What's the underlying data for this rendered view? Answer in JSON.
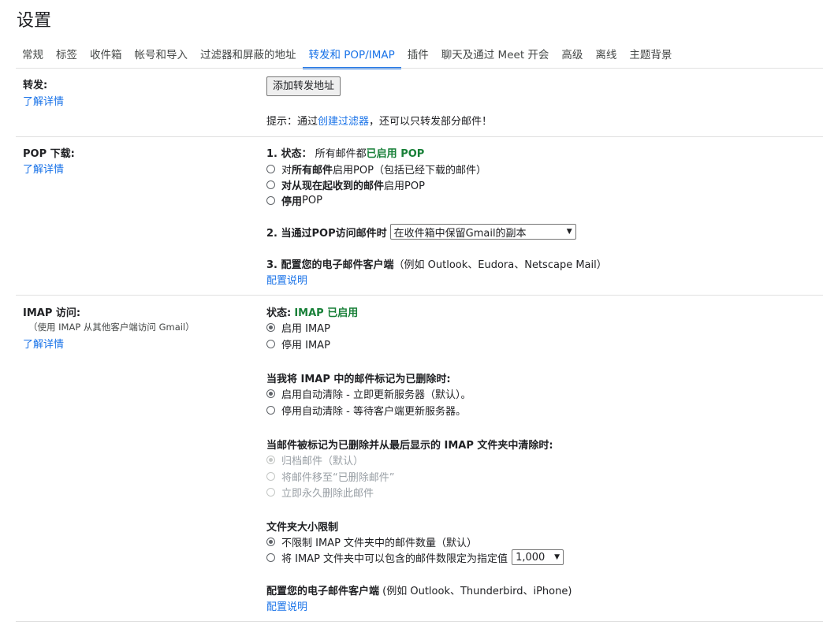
{
  "page_title": "设置",
  "tabs": [
    {
      "label": "常规"
    },
    {
      "label": "标签"
    },
    {
      "label": "收件箱"
    },
    {
      "label": "帐号和导入"
    },
    {
      "label": "过滤器和屏蔽的地址"
    },
    {
      "label": "转发和 POP/IMAP",
      "active": true
    },
    {
      "label": "插件"
    },
    {
      "label": "聊天及通过 Meet 开会"
    },
    {
      "label": "高级"
    },
    {
      "label": "离线"
    },
    {
      "label": "主题背景"
    }
  ],
  "forwarding": {
    "label": "转发:",
    "learn_more": "了解详情",
    "add_button": "添加转发地址",
    "tip_prefix": "提示：通过",
    "tip_link": "创建过滤器",
    "tip_suffix": "，还可以只转发部分邮件！"
  },
  "pop": {
    "label": "POP 下载:",
    "learn_more": "了解详情",
    "status_label": "1. 状态：",
    "status_text": "所有邮件都",
    "status_value": "已启用 POP",
    "options": [
      {
        "pre": "对",
        "bold": "所有邮件",
        "post": "启用POP（包括已经下载的邮件）",
        "checked": false
      },
      {
        "pre": "",
        "bold": "对从现在起收到的邮件",
        "post": "启用POP",
        "checked": false
      },
      {
        "pre": "",
        "bold": "停用",
        "post": "POP",
        "checked": false
      }
    ],
    "access_label": "2. 当通过POP访问邮件时",
    "access_select": "在收件箱中保留Gmail的副本",
    "config_label": "3. 配置您的电子邮件客户端",
    "config_example": "（例如 Outlook、Eudora、Netscape Mail）",
    "config_link": "配置说明"
  },
  "imap": {
    "label": "IMAP 访问:",
    "sublabel": "（使用 IMAP 从其他客户端访问 Gmail）",
    "learn_more": "了解详情",
    "status_label": "状态:",
    "status_value": "IMAP 已启用",
    "enable_options": [
      {
        "label": "启用 IMAP",
        "checked": true
      },
      {
        "label": "停用 IMAP",
        "checked": false
      }
    ],
    "delete_heading": "当我将 IMAP 中的邮件标记为已删除时:",
    "delete_options": [
      {
        "label": "启用自动清除 - 立即更新服务器（默认）。",
        "checked": true
      },
      {
        "label": "停用自动清除 - 等待客户端更新服务器。",
        "checked": false
      }
    ],
    "expunge_heading": "当邮件被标记为已删除并从最后显示的 IMAP 文件夹中清除时:",
    "expunge_options": [
      {
        "label": "归档邮件（默认）",
        "checked": true
      },
      {
        "label": "将邮件移至“已删除邮件”",
        "checked": false
      },
      {
        "label": "立即永久删除此邮件",
        "checked": false
      }
    ],
    "folder_heading": "文件夹大小限制",
    "folder_options": [
      {
        "label": "不限制 IMAP 文件夹中的邮件数量（默认）",
        "checked": true
      },
      {
        "label": "将 IMAP 文件夹中可以包含的邮件数限定为指定值",
        "checked": false
      }
    ],
    "folder_limit_select": "1,000",
    "config_label": "配置您的电子邮件客户端",
    "config_example": "(例如 Outlook、Thunderbird、iPhone)",
    "config_link": "配置说明"
  }
}
